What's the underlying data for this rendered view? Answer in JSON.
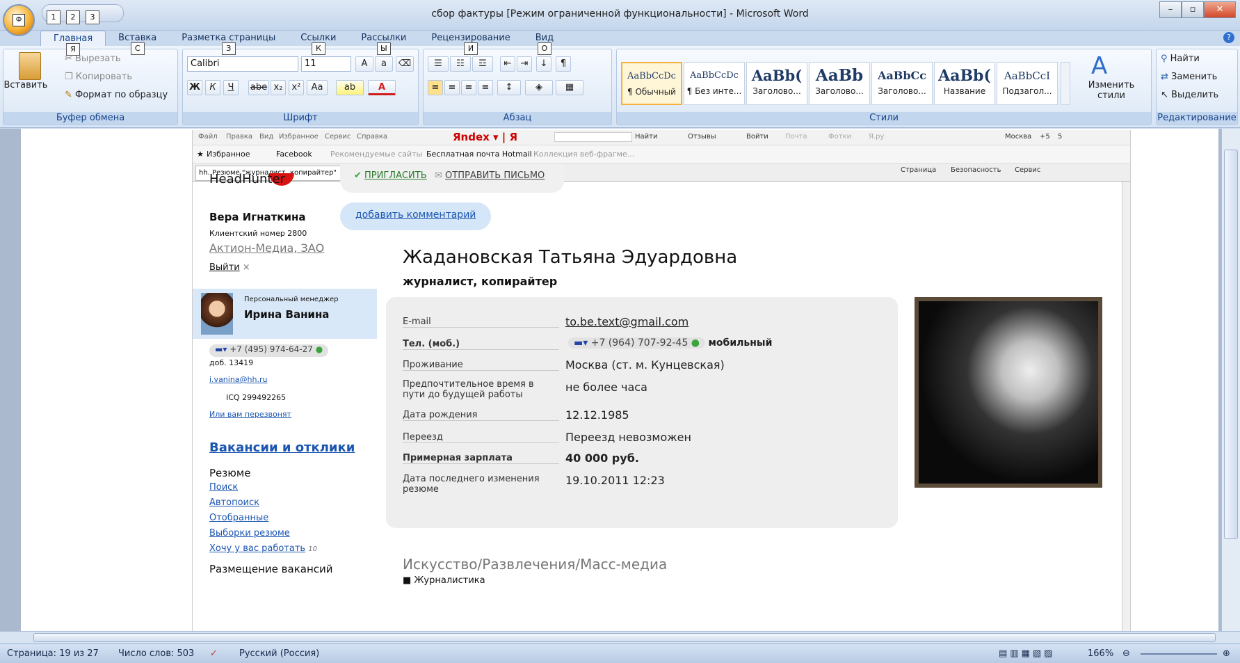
{
  "window": {
    "title": "сбор фактуры [Режим ограниченной функциональности] - Microsoft Word",
    "office_key": "Ф",
    "qat_keys": [
      "1",
      "2",
      "3"
    ]
  },
  "tabs": [
    {
      "label": "Главная",
      "key": "Я"
    },
    {
      "label": "Вставка",
      "key": "С"
    },
    {
      "label": "Разметка страницы",
      "key": "З"
    },
    {
      "label": "Ссылки",
      "key": "К"
    },
    {
      "label": "Рассылки",
      "key": "Ы"
    },
    {
      "label": "Рецензирование",
      "key": "И"
    },
    {
      "label": "Вид",
      "key": "О"
    }
  ],
  "ribbon": {
    "clipboard": {
      "label": "Буфер обмена",
      "paste": "Вставить",
      "cut": "Вырезать",
      "copy": "Копировать",
      "format_painter": "Формат по образцу"
    },
    "font": {
      "label": "Шрифт",
      "font_name": "Calibri",
      "font_size": "11",
      "bold": "Ж",
      "italic": "К",
      "underline": "Ч",
      "strike": "abe",
      "subscript": "x₂",
      "superscript": "x²",
      "case": "Aa"
    },
    "paragraph": {
      "label": "Абзац"
    },
    "styles": {
      "label": "Стили",
      "change": "Изменить стили",
      "items": [
        {
          "preview": "AaBbCcDc",
          "name": "¶ Обычный"
        },
        {
          "preview": "AaBbCcDc",
          "name": "¶ Без инте..."
        },
        {
          "preview": "AaBb(",
          "name": "Заголово..."
        },
        {
          "preview": "AaBb",
          "name": "Заголово..."
        },
        {
          "preview": "AaBbCc",
          "name": "Заголово..."
        },
        {
          "preview": "AaBb(",
          "name": "Название"
        },
        {
          "preview": "AaBbCcI",
          "name": "Подзагол..."
        }
      ]
    },
    "editing": {
      "label": "Редактирование",
      "find": "Найти",
      "replace": "Заменить",
      "select": "Выделить"
    }
  },
  "browser": {
    "menu": [
      "Файл",
      "Правка",
      "Вид",
      "Избранное",
      "Сервис",
      "Справка"
    ],
    "toolbar_right": [
      "Найти",
      "Отзывы",
      "Войти",
      "Почта",
      "Фотки",
      "Я.ру",
      "Москва",
      "+5",
      "5"
    ],
    "favorites": [
      "Избранное",
      "Facebook",
      "Рекомендуемые сайты",
      "Бесплатная почта Hotmail",
      "Коллекция веб-фрагме..."
    ],
    "tab_title": "hh. Резюме \"журналист, копирайтер\"",
    "cmd": [
      "Страница",
      "Безопасность",
      "Сервис"
    ]
  },
  "site": {
    "logo": "HeadHunter",
    "user": {
      "name": "Вера Игнаткина",
      "client": "Клиентский номер 2800",
      "company": "Актион-Медиа, ЗАО",
      "logout": "Выйти"
    },
    "manager": {
      "caption": "Персональный менеджер",
      "name": "Ирина Ванина",
      "phone": "+7 (495) 974-64-27",
      "ext": "доб. 13419",
      "email": "i.vanina@hh.ru",
      "icq": "ICQ 299492265",
      "callback": "Или вам перезвонят"
    },
    "nav": {
      "heading": "Вакансии и отклики",
      "resume": "Резюме",
      "links": [
        "Поиск",
        "Автопоиск",
        "Отобранные",
        "Выборки резюме",
        "Хочу у вас работать"
      ],
      "want_count": "10",
      "vacancies": "Размещение вакансий"
    },
    "actions": {
      "invite": "ПРИГЛАСИТЬ",
      "send": "ОТПРАВИТЬ ПИСЬМО",
      "comment": "добавить комментарий"
    },
    "candidate": {
      "name": "Жадановская Татьяна Эдуардовна",
      "title": "журналист, копирайтер"
    },
    "fields": [
      {
        "label": "E-mail",
        "value": "to.be.text@gmail.com"
      },
      {
        "label": "Тел. (моб.)",
        "value": "+7 (964) 707-92-45",
        "extra": "мобильный"
      },
      {
        "label": "Проживание",
        "value": "Москва (ст. м. Кунцевская)"
      },
      {
        "label": "Предпочтительное время в пути до будущей работы",
        "value": "не более часа"
      },
      {
        "label": "Дата рождения",
        "value": "12.12.1985"
      },
      {
        "label": "Переезд",
        "value": "Переезд невозможен"
      },
      {
        "label": "Примерная зарплата",
        "value": "40 000 руб."
      },
      {
        "label": "Дата последнего изменения резюме",
        "value": "19.10.2011 12:23"
      }
    ],
    "industry": "Искусство/Развлечения/Масс-медиа",
    "industry_item": "Журналистика"
  },
  "status": {
    "page": "Страница: 19 из 27",
    "words": "Число слов: 503",
    "lang": "Русский (Россия)",
    "zoom": "166%"
  }
}
